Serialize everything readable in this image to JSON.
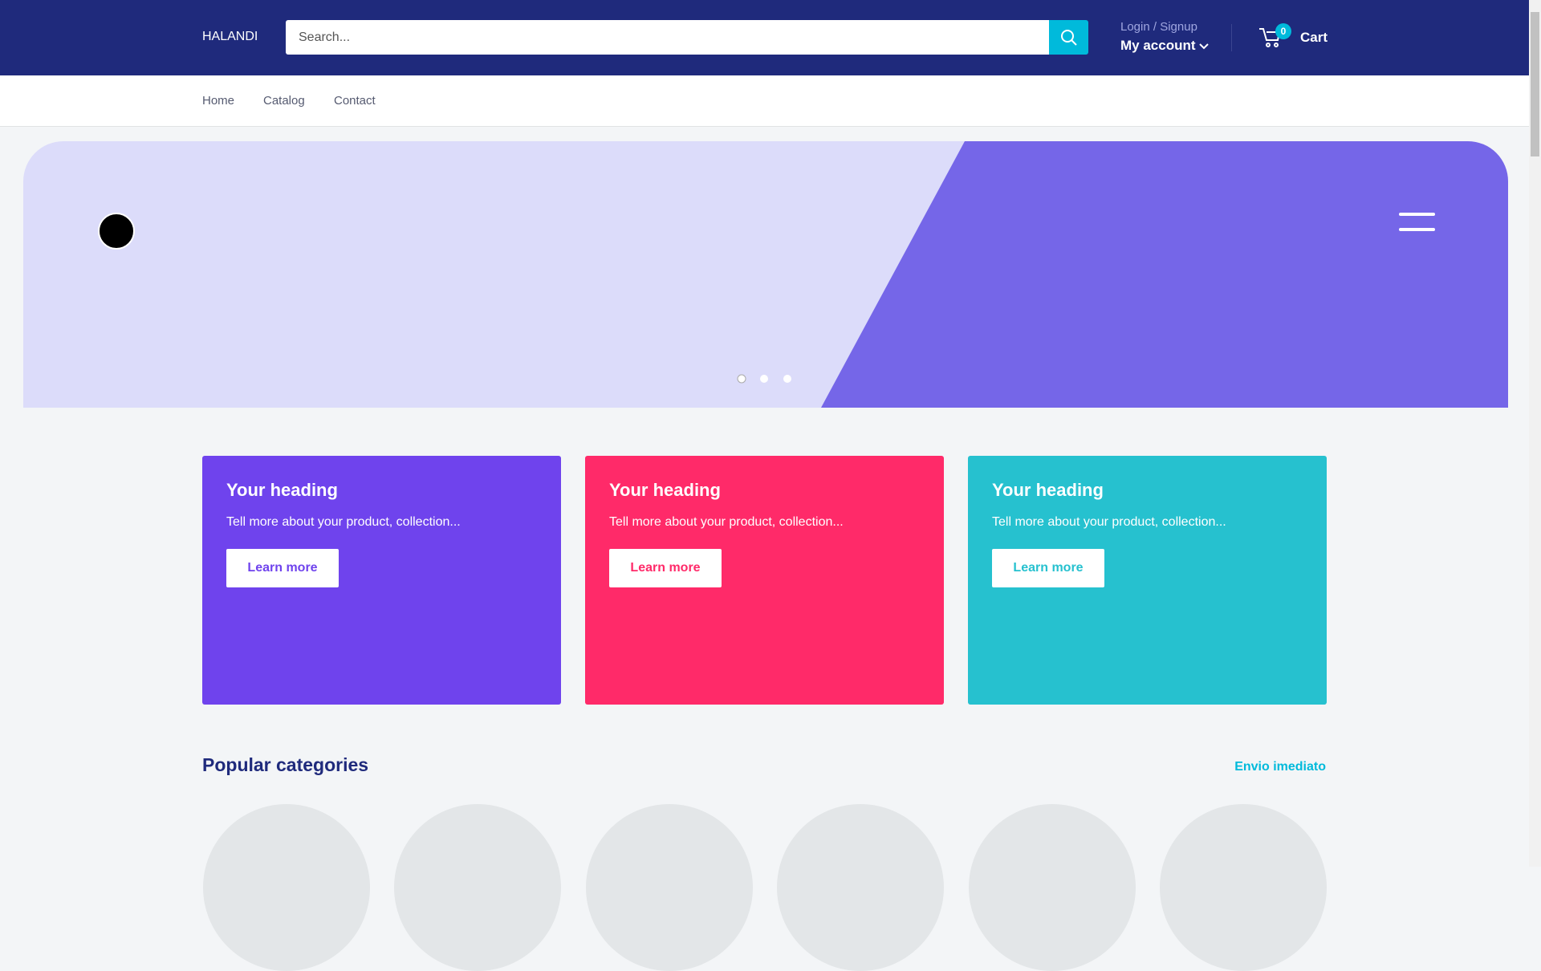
{
  "header": {
    "logo": "HALANDI",
    "search_placeholder": "Search...",
    "login": "Login / Signup",
    "account": "My account",
    "cart_count": "0",
    "cart": "Cart"
  },
  "nav": [
    "Home",
    "Catalog",
    "Contact"
  ],
  "slider": {
    "dots": 3,
    "active": 0
  },
  "cards": [
    {
      "heading": "Your heading",
      "text": "Tell more about your product, collection...",
      "button": "Learn more",
      "color": "#6f43ed"
    },
    {
      "heading": "Your heading",
      "text": "Tell more about your product, collection...",
      "button": "Learn more",
      "color": "#ff2a69"
    },
    {
      "heading": "Your heading",
      "text": "Tell more about your product, collection...",
      "button": "Learn more",
      "color": "#26c1cf"
    }
  ],
  "categories": {
    "title": "Popular categories",
    "link": "Envio imediato",
    "count": 6
  }
}
